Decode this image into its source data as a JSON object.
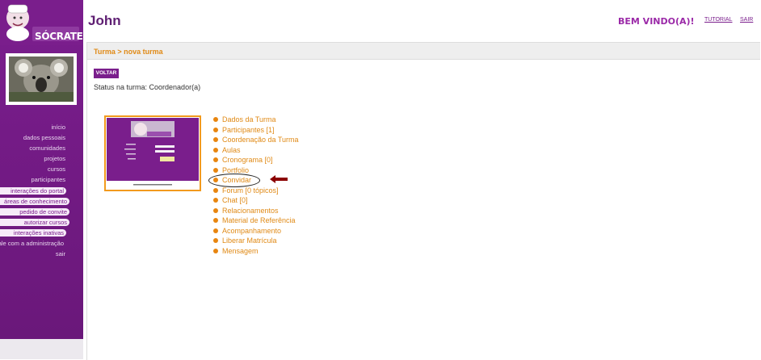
{
  "app": {
    "logo_text": "SÓCRATES"
  },
  "header": {
    "title": "John",
    "welcome": "BEM VINDO(A)!",
    "tutorial": "TUTORIAL",
    "exit": "SAIR"
  },
  "sidebar": {
    "links": [
      "início",
      "dados pessoais",
      "comunidades",
      "projetos",
      "cursos",
      "participantes"
    ],
    "pills": [
      "interações do portal",
      "áreas de conhecimento",
      "pedido de convite",
      "autorizar cursos",
      "interações inativas"
    ],
    "bottom_links": [
      "fale com a administração",
      "sair"
    ]
  },
  "breadcrumb": "Turma > nova turma",
  "back_button": "VOLTAR",
  "status": "Status na turma: Coordenador(a)",
  "menu": [
    "Dados da Turma",
    "Participantes [1]",
    "Coordenação da Turma",
    "Aulas",
    "Cronograma [0]",
    "Portfolio",
    "Convidar",
    "Forum [0 tópicos]",
    "Chat [0]",
    "Relacionamentos",
    "Material de Referência",
    "Acompanhamento",
    "Liberar Matrícula",
    "Mensagem"
  ],
  "colors": {
    "brand": "#7a1e8c",
    "accent": "#e08a16"
  },
  "icons": {
    "arrow": "red-arrow-icon",
    "bullet": "orange-bullet-icon"
  }
}
